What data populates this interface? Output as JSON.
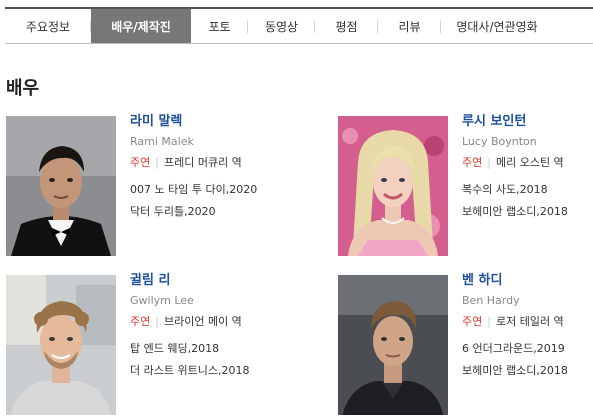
{
  "tabs": [
    {
      "label": "주요정보",
      "active": false
    },
    {
      "label": "배우/제작진",
      "active": true
    },
    {
      "label": "포토",
      "active": false
    },
    {
      "label": "동영상",
      "active": false
    },
    {
      "label": "평점",
      "active": false
    },
    {
      "label": "리뷰",
      "active": false
    },
    {
      "label": "명대사/연관영화",
      "active": false
    }
  ],
  "section_title": "배우",
  "actors": [
    {
      "name": "라미 말렉",
      "english_name": "Rami Malek",
      "role_type": "주연",
      "character": "프레디 머큐리 역",
      "works": [
        "007 노 타임 투 다이,2020",
        "닥터 두리틀,2020"
      ],
      "photo_icon": "actor-portrait-dark-suit-bowtie"
    },
    {
      "name": "루시 보인턴",
      "english_name": "Lucy Boynton",
      "role_type": "주연",
      "character": "메리 오스틴 역",
      "works": [
        "복수의 사도,2018",
        "보헤미안 랩소디,2018"
      ],
      "photo_icon": "actor-portrait-blonde-pink"
    },
    {
      "name": "귈림 리",
      "english_name": "Gwilym Lee",
      "role_type": "주연",
      "character": "브라이언 메이 역",
      "works": [
        "탑 엔드 웨딩,2018",
        "더 라스트 위트니스,2018"
      ],
      "photo_icon": "actor-portrait-curly-hair-outdoor"
    },
    {
      "name": "벤 하디",
      "english_name": "Ben Hardy",
      "role_type": "주연",
      "character": "로저 테일러 역",
      "works": [
        "6 언더그라운드,2019",
        "보헤미안 랩소디,2018"
      ],
      "photo_icon": "actor-portrait-dark-jacket"
    }
  ],
  "colors": {
    "active_tab_bg": "#777777",
    "name_link": "#1c4f9c",
    "role_type": "#d33a2c"
  }
}
